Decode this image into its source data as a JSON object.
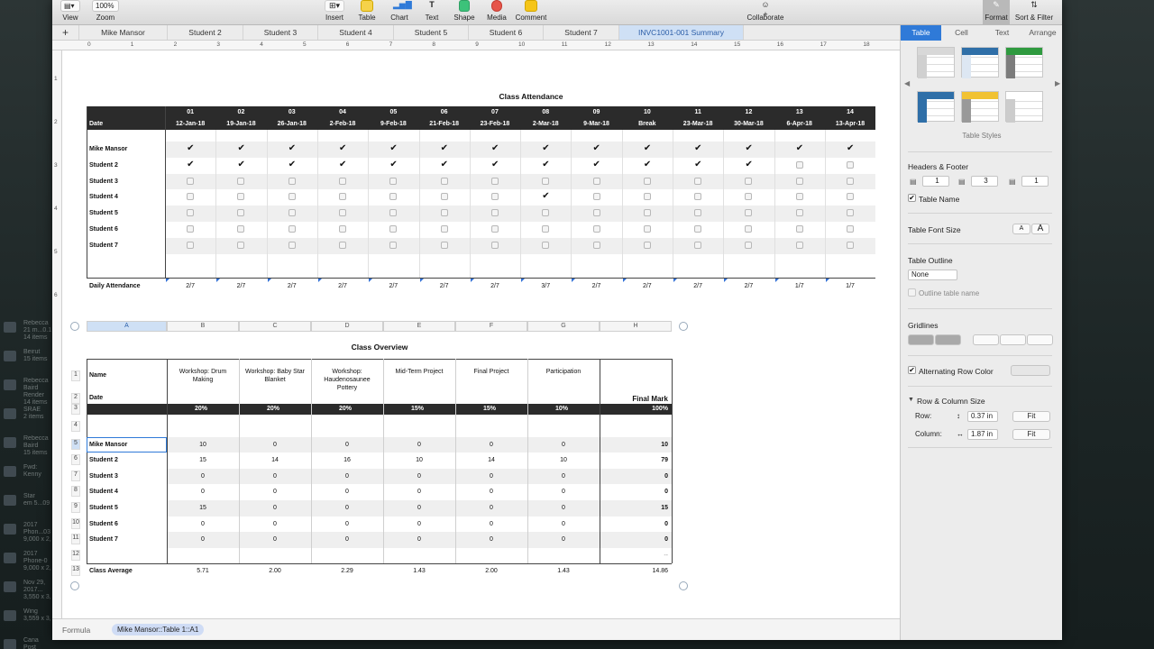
{
  "toolbar": {
    "view_label": "View",
    "zoom_value": "100%",
    "zoom_label": "Zoom",
    "insert_label": "Insert",
    "table_label": "Table",
    "chart_label": "Chart",
    "text_label": "Text",
    "shape_label": "Shape",
    "media_label": "Media",
    "comment_label": "Comment",
    "collaborate_label": "Collaborate",
    "format_label": "Format",
    "sort_filter_label": "Sort & Filter"
  },
  "sheet_tabs": [
    "Mike Mansor",
    "Student 2",
    "Student 3",
    "Student 4",
    "Student 5",
    "Student 6",
    "Student 7",
    "INVC1001-001 Summary"
  ],
  "active_tab_index": 7,
  "ruler_numbers": [
    "0",
    "1",
    "2",
    "3",
    "4",
    "5",
    "6",
    "7",
    "8",
    "9",
    "10",
    "11",
    "12",
    "13",
    "14",
    "15",
    "16",
    "17",
    "18"
  ],
  "attendance": {
    "title": "Class Attendance",
    "date_label": "Date",
    "weeks": [
      "01",
      "02",
      "03",
      "04",
      "05",
      "06",
      "07",
      "08",
      "09",
      "10",
      "11",
      "12",
      "13",
      "14"
    ],
    "dates": [
      "12-Jan-18",
      "19-Jan-18",
      "26-Jan-18",
      "2-Feb-18",
      "9-Feb-18",
      "21-Feb-18",
      "23-Feb-18",
      "2-Mar-18",
      "9-Mar-18",
      "Break",
      "23-Mar-18",
      "30-Mar-18",
      "6-Apr-18",
      "13-Apr-18"
    ],
    "students": [
      "Mike Mansor",
      "Student 2",
      "Student 3",
      "Student 4",
      "Student 5",
      "Student 6",
      "Student 7"
    ],
    "checks": [
      [
        1,
        1,
        1,
        1,
        1,
        1,
        1,
        1,
        1,
        1,
        1,
        1,
        1,
        1
      ],
      [
        1,
        1,
        1,
        1,
        1,
        1,
        1,
        1,
        1,
        1,
        1,
        1,
        0,
        0
      ],
      [
        0,
        0,
        0,
        0,
        0,
        0,
        0,
        0,
        0,
        0,
        0,
        0,
        0,
        0
      ],
      [
        0,
        0,
        0,
        0,
        0,
        0,
        0,
        1,
        0,
        0,
        0,
        0,
        0,
        0
      ],
      [
        0,
        0,
        0,
        0,
        0,
        0,
        0,
        0,
        0,
        0,
        0,
        0,
        0,
        0
      ],
      [
        0,
        0,
        0,
        0,
        0,
        0,
        0,
        0,
        0,
        0,
        0,
        0,
        0,
        0
      ],
      [
        0,
        0,
        0,
        0,
        0,
        0,
        0,
        0,
        0,
        0,
        0,
        0,
        0,
        0
      ]
    ],
    "daily_label": "Daily Attendance",
    "daily": [
      "2/7",
      "2/7",
      "2/7",
      "2/7",
      "2/7",
      "2/7",
      "2/7",
      "3/7",
      "2/7",
      "2/7",
      "2/7",
      "2/7",
      "1/7",
      "1/7"
    ]
  },
  "overview": {
    "title": "Class Overview",
    "col_letters": [
      "A",
      "B",
      "C",
      "D",
      "E",
      "F",
      "G",
      "H"
    ],
    "row_numbers": [
      "1",
      "2",
      "3",
      "4",
      "5",
      "6",
      "7",
      "8",
      "9",
      "10",
      "11",
      "12",
      "13"
    ],
    "name_label": "Name",
    "date_label": "Date",
    "final_mark_label": "Final Mark",
    "columns": [
      "Workshop: Drum Making",
      "Workshop: Baby Star Blanket",
      "Workshop: Haudenosaunee Pottery",
      "Mid-Term Project",
      "Final Project",
      "Participation"
    ],
    "weights": [
      "20%",
      "20%",
      "20%",
      "15%",
      "15%",
      "10%",
      "100%"
    ],
    "rows": [
      {
        "name": "Mike Mansor",
        "values": [
          "10",
          "0",
          "0",
          "0",
          "0",
          "0"
        ],
        "final": "10"
      },
      {
        "name": "Student 2",
        "values": [
          "15",
          "14",
          "16",
          "10",
          "14",
          "10"
        ],
        "final": "79"
      },
      {
        "name": "Student 3",
        "values": [
          "0",
          "0",
          "0",
          "0",
          "0",
          "0"
        ],
        "final": "0"
      },
      {
        "name": "Student 4",
        "values": [
          "0",
          "0",
          "0",
          "0",
          "0",
          "0"
        ],
        "final": "0"
      },
      {
        "name": "Student 5",
        "values": [
          "15",
          "0",
          "0",
          "0",
          "0",
          "0"
        ],
        "final": "15"
      },
      {
        "name": "Student 6",
        "values": [
          "0",
          "0",
          "0",
          "0",
          "0",
          "0"
        ],
        "final": "0"
      },
      {
        "name": "Student 7",
        "values": [
          "0",
          "0",
          "0",
          "0",
          "0",
          "0"
        ],
        "final": "0"
      }
    ],
    "empty_final": "--",
    "average_label": "Class Average",
    "averages": [
      "5.71",
      "2.00",
      "2.29",
      "1.43",
      "2.00",
      "1.43"
    ],
    "average_final": "14.86"
  },
  "formula_bar": {
    "label": "Formula",
    "reference": "Mike Mansor::Table 1::A1"
  },
  "inspector": {
    "tabs": [
      "Table",
      "Cell",
      "Text",
      "Arrange"
    ],
    "active_tab_index": 0,
    "table_styles_label": "Table Styles",
    "headers_footer_label": "Headers & Footer",
    "header_rows": "1",
    "header_cols": "3",
    "footer_rows": "1",
    "table_name_label": "Table Name",
    "table_name_checked": true,
    "font_size_label": "Table Font Size",
    "font_small": "A",
    "font_large": "A",
    "outline_label": "Table Outline",
    "outline_value": "None",
    "outline_name_label": "Outline table name",
    "gridlines_label": "Gridlines",
    "alternating_label": "Alternating Row Color",
    "alternating_checked": true,
    "row_col_size_label": "Row & Column Size",
    "row_label": "Row:",
    "row_value": "0.37 in",
    "column_label": "Column:",
    "column_value": "1.87 in",
    "fit_label": "Fit"
  },
  "desktop_items": [
    {
      "name": "Rebecca",
      "sub": "21 m...0.1",
      "sub2": "14 items"
    },
    {
      "name": "Beirut",
      "sub": "",
      "sub2": "15 items"
    },
    {
      "name": "Rebecca Baird",
      "sub": "Render",
      "sub2": "14 items"
    },
    {
      "name": "SRAE",
      "sub": "2 items",
      "sub2": ""
    },
    {
      "name": "Rebecca Baird",
      "sub": "15 items",
      "sub2": ""
    },
    {
      "name": "Fwd: Kenny",
      "sub": "",
      "sub2": ""
    },
    {
      "name": "Star",
      "sub": "em 5...09",
      "sub2": ""
    },
    {
      "name": "2017",
      "sub": "Phon...03",
      "sub2": "9,000 x 2,"
    },
    {
      "name": "2017",
      "sub": "Phone-0",
      "sub2": "9,000 x 2,"
    },
    {
      "name": "Nov 29,",
      "sub": "2017...",
      "sub2": "3,550 x 3,"
    },
    {
      "name": "Wing",
      "sub": "3,559 x 3,",
      "sub2": ""
    },
    {
      "name": "Cana",
      "sub": "Post",
      "sub2": ""
    }
  ],
  "colors": {
    "accent": "#2f7ad8",
    "header_dark": "#2b2b2b",
    "stripe": "#efefef",
    "tab_active": "#cfe0f5"
  }
}
